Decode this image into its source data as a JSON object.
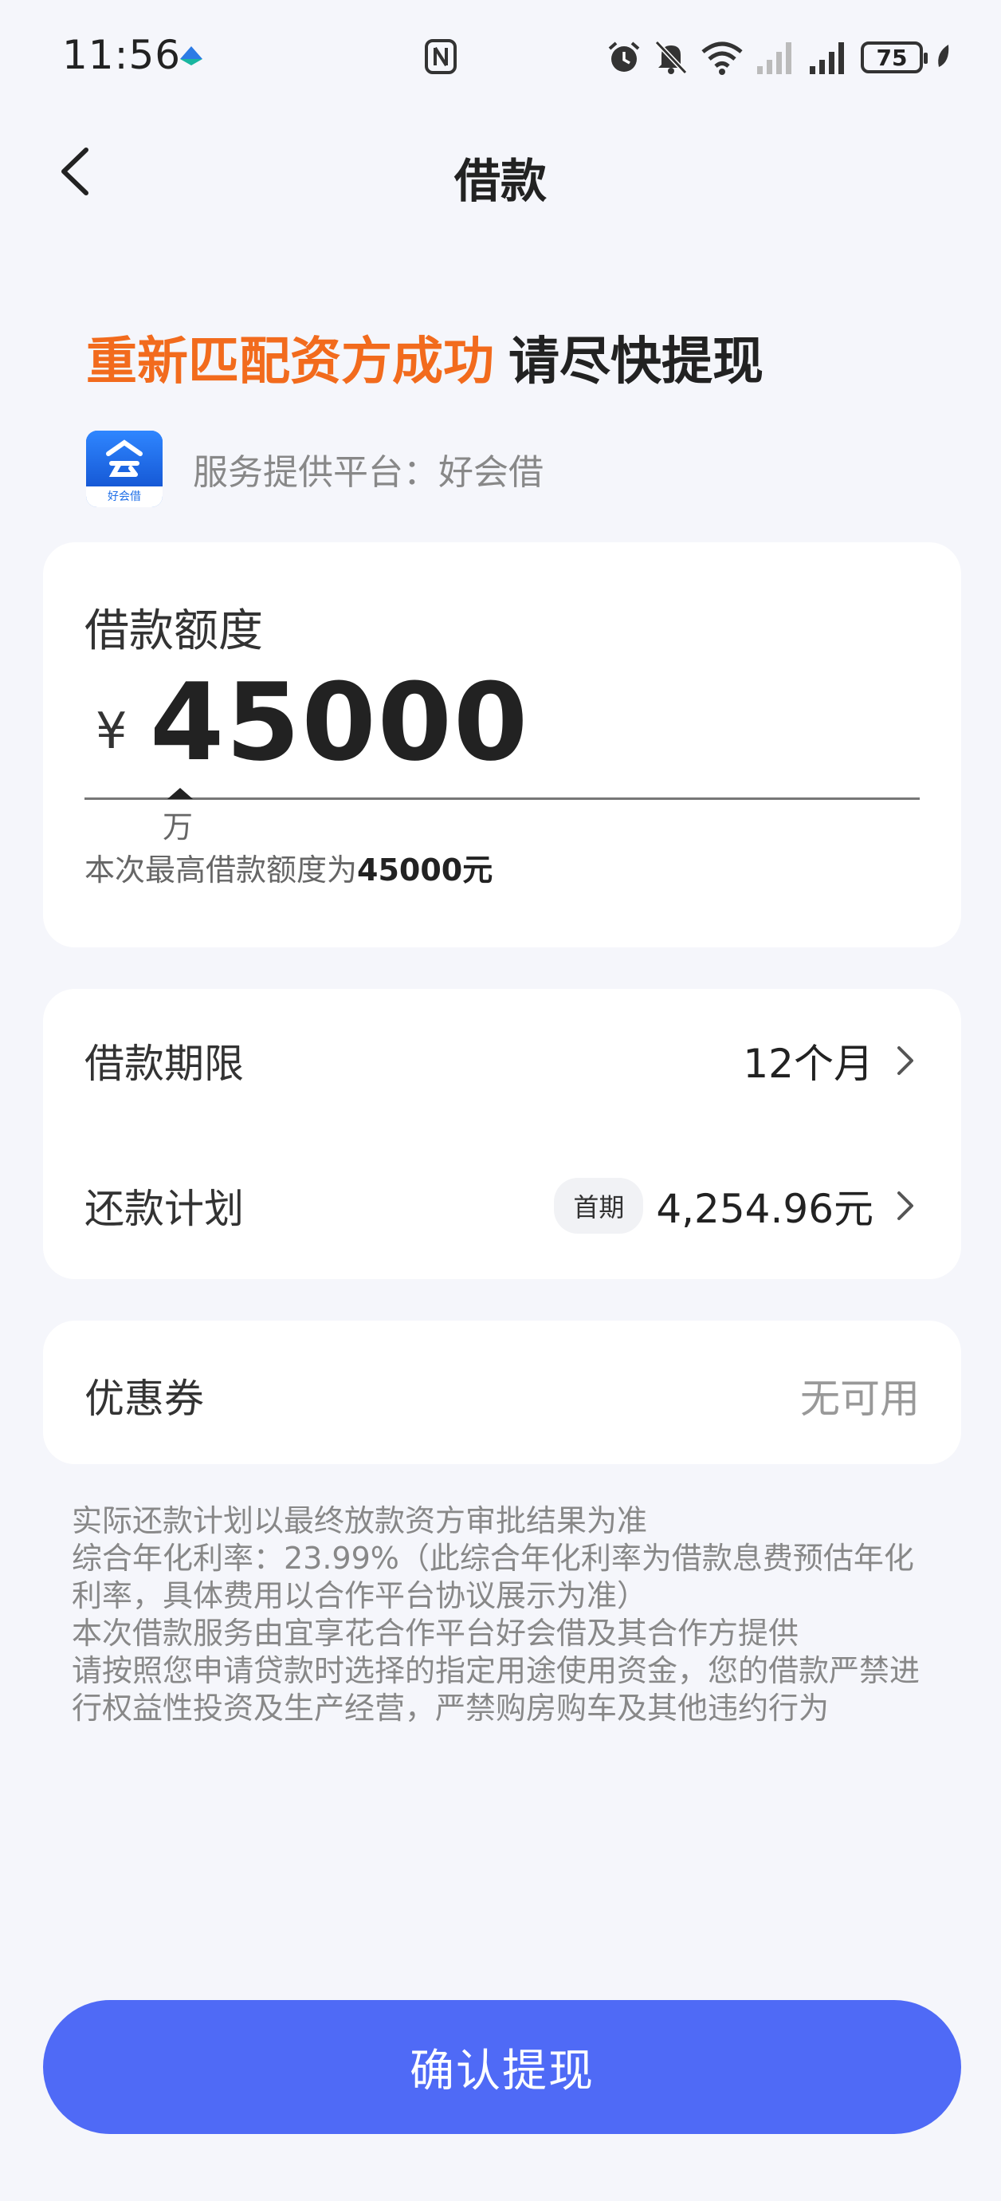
{
  "status_bar": {
    "time": "11:56",
    "battery": "75",
    "icons": [
      "app-notification-icon",
      "nfc-icon",
      "alarm-icon",
      "mute-icon",
      "wifi-icon",
      "signal-icon",
      "signal-icon",
      "battery-icon",
      "leaf-icon"
    ]
  },
  "nav": {
    "title": "借款"
  },
  "headline": {
    "highlight": "重新匹配资方成功",
    "rest": "请尽快提现"
  },
  "provider": {
    "logo_label": "好会借",
    "text": "服务提供平台：好会借"
  },
  "amount": {
    "label": "借款额度",
    "currency": "¥",
    "value": "45000",
    "unit": "万",
    "hint_prefix": "本次最高借款额度为",
    "hint_value": "45000元"
  },
  "terms": {
    "period_label": "借款期限",
    "period_value": "12个月",
    "plan_label": "还款计划",
    "plan_badge": "首期",
    "plan_value": "4,254.96元"
  },
  "coupon": {
    "label": "优惠券",
    "value": "无可用"
  },
  "disclaimer": [
    "实际还款计划以最终放款资方审批结果为准",
    "综合年化利率：23.99%（此综合年化利率为借款息费预估年化利率，具体费用以合作平台协议展示为准）",
    "本次借款服务由宜享花合作平台好会借及其合作方提供",
    "请按照您申请贷款时选择的指定用途使用资金，您的借款严禁进行权益性投资及生产经营，严禁购房购车及其他违约行为"
  ],
  "cta": {
    "label": "确认提现"
  },
  "colors": {
    "accent": "#4f6af6",
    "highlight": "#f26b1d",
    "background": "#f5f6fb"
  }
}
